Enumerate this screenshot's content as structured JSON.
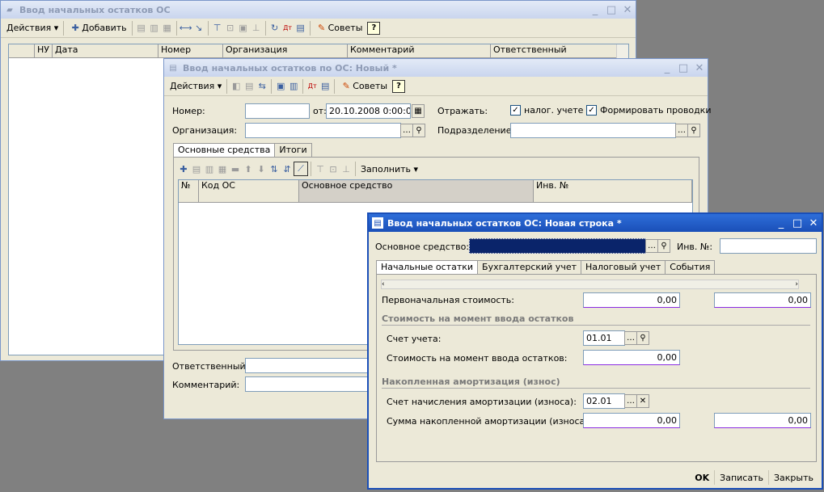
{
  "win1": {
    "title": "Ввод начальных остатков ОС",
    "toolbar": {
      "actions": "Действия",
      "add": "Добавить",
      "tips": "Советы",
      "help": "?"
    },
    "columns": [
      "НУ",
      "Дата",
      "Номер",
      "Организация",
      "Комментарий",
      "Ответственный"
    ]
  },
  "win2": {
    "title": "Ввод начальных остатков по ОС: Новый *",
    "toolbar": {
      "actions": "Действия",
      "tips": "Советы",
      "help": "?"
    },
    "number_label": "Номер:",
    "number_value": "",
    "from_label": "от:",
    "date_value": "20.10.2008  0:00:00",
    "reflect_label": "Отражать:",
    "tax_check_label": "налог. учете",
    "postings_check_label": "Формировать проводки",
    "org_label": "Организация:",
    "org_value": "",
    "dept_label": "Подразделение:",
    "dept_value": "",
    "tabs": [
      "Основные средства",
      "Итоги"
    ],
    "fill_label": "Заполнить",
    "columns": [
      "№",
      "Код ОС",
      "Основное средство",
      "Инв. №"
    ],
    "responsible_label": "Ответственный:",
    "comment_label": "Комментарий:"
  },
  "win3": {
    "title": "Ввод начальных остатков ОС: Новая строка *",
    "asset_label": "Основное средство:",
    "inv_label": "Инв. №:",
    "inv_value": "",
    "tabs": [
      "Начальные остатки",
      "Бухгалтерский учет",
      "Налоговый учет",
      "События"
    ],
    "initial_cost_label": "Первоначальная стоимость:",
    "initial_cost_value": "0,00",
    "initial_cost_value2": "0,00",
    "group1_title": "Стоимость на момент ввода остатков",
    "account_label": "Счет учета:",
    "account_value": "01.01",
    "cost_at_entry_label": "Стоимость на момент ввода остатков:",
    "cost_at_entry_value": "0,00",
    "group2_title": "Накопленная амортизация (износ)",
    "depr_account_label": "Счет начисления амортизации (износа):",
    "depr_account_value": "02.01",
    "accum_depr_label": "Сумма накопленной амортизации (износа):",
    "accum_depr_value": "0,00",
    "accum_depr_value2": "0,00",
    "ok": "OK",
    "save": "Записать",
    "close": "Закрыть"
  }
}
